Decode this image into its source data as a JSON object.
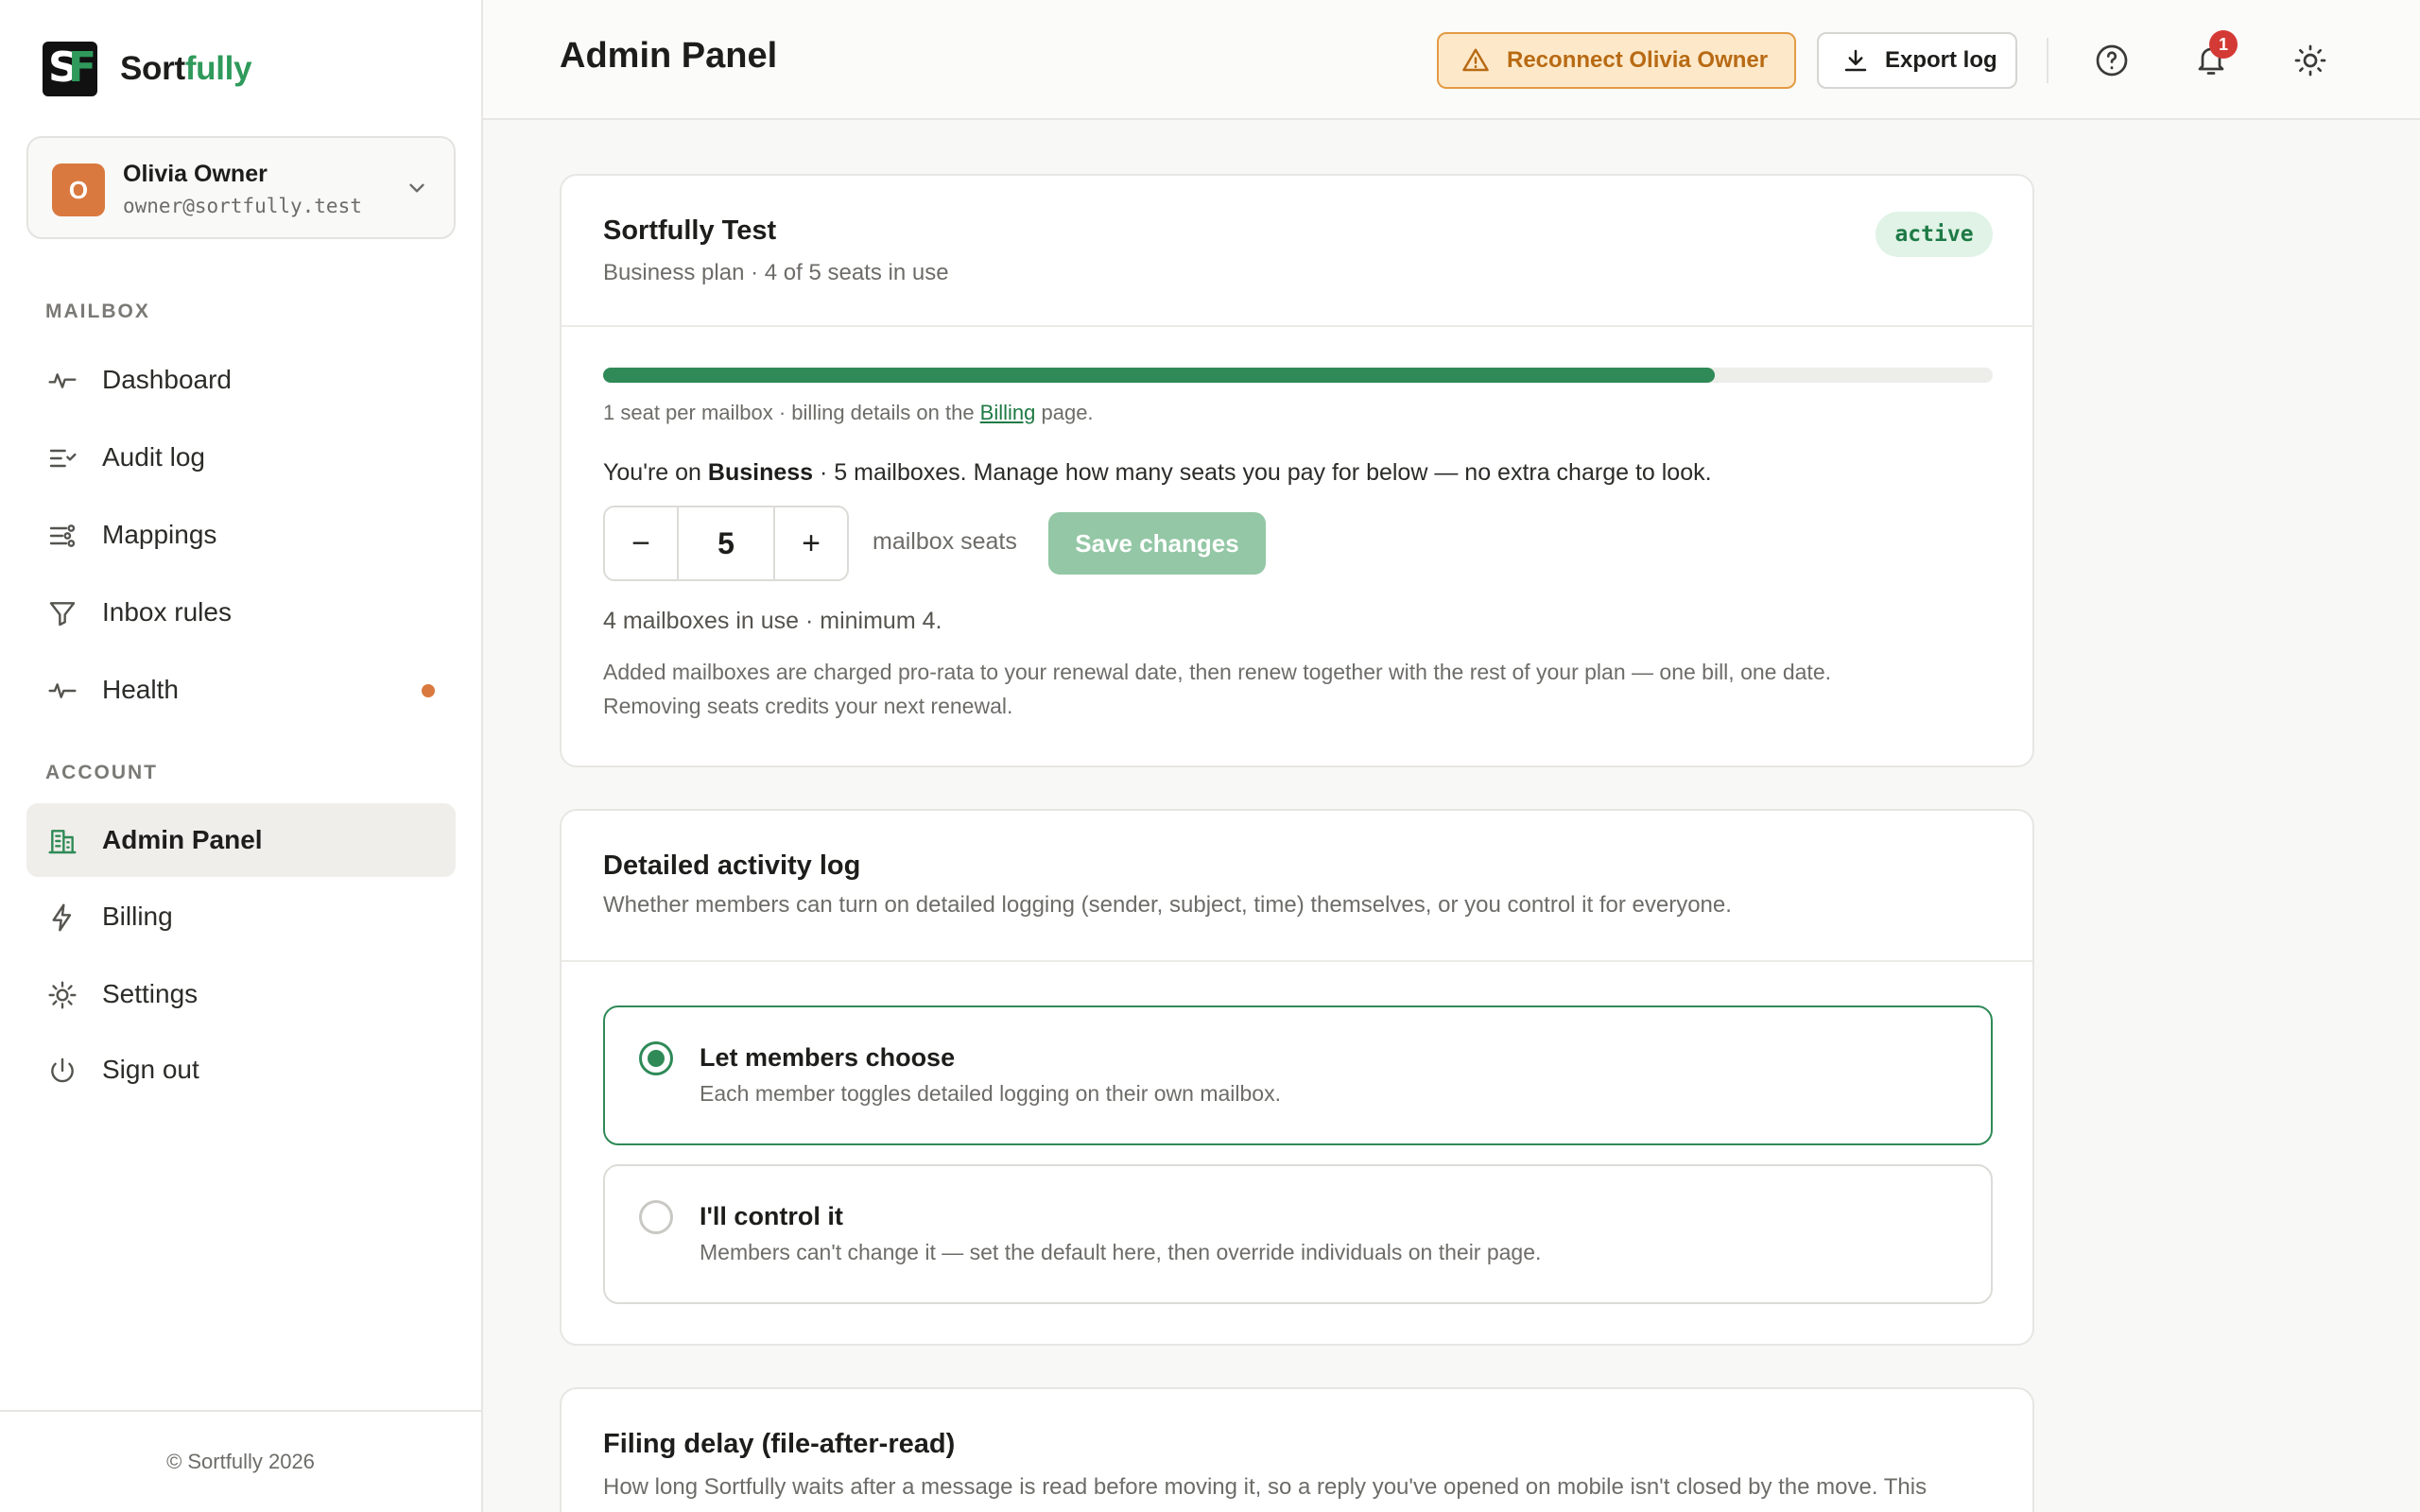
{
  "brand": {
    "name_a": "Sort",
    "name_b": "fully",
    "logo_s": "S",
    "logo_f": "F"
  },
  "user": {
    "initial": "O",
    "name": "Olivia Owner",
    "email": "owner@sortfully.test"
  },
  "sidebar": {
    "mailbox_label": "MAILBOX",
    "account_label": "ACCOUNT",
    "mailbox_items": [
      {
        "label": "Dashboard",
        "icon": "activity-icon"
      },
      {
        "label": "Audit log",
        "icon": "list-check-icon"
      },
      {
        "label": "Mappings",
        "icon": "sliders-icon"
      },
      {
        "label": "Inbox rules",
        "icon": "filter-icon"
      },
      {
        "label": "Health",
        "icon": "pulse-icon"
      }
    ],
    "account_items": [
      {
        "label": "Admin Panel",
        "icon": "building-icon"
      },
      {
        "label": "Billing",
        "icon": "bolt-icon"
      },
      {
        "label": "Settings",
        "icon": "gear-icon"
      },
      {
        "label": "Sign out",
        "icon": "power-icon"
      }
    ],
    "footer": "© Sortfully 2026"
  },
  "header": {
    "title": "Admin Panel",
    "reconnect_label": "Reconnect Olivia Owner",
    "export_label": "Export log",
    "notification_count": "1"
  },
  "plan_card": {
    "title": "Sortfully Test",
    "subtitle": "Business plan · 4 of 5 seats in use",
    "status": "active",
    "seats_used_fraction": 0.8,
    "note_prefix": "1 seat per mailbox · billing details on the ",
    "note_link": "Billing",
    "note_suffix": " page.",
    "line_prefix": "You're on ",
    "line_plan": "Business",
    "line_suffix": " · 5 mailboxes. Manage how many seats you pay for below — no extra charge to look.",
    "stepper_minus": "−",
    "stepper_value": "5",
    "stepper_plus": "+",
    "seat_label": "mailbox seats",
    "save_label": "Save changes",
    "usage_note": "4 mailboxes in use · minimum 4.",
    "prorata_1": "Added mailboxes are charged pro-rata to your renewal date, then renew together with the rest of your plan — one bill, one date.",
    "prorata_2": "Removing seats credits your next renewal."
  },
  "activity_card": {
    "title": "Detailed activity log",
    "subtitle": "Whether members can turn on detailed logging (sender, subject, time) themselves, or you control it for everyone.",
    "options": [
      {
        "title": "Let members choose",
        "desc": "Each member toggles detailed logging on their own mailbox.",
        "selected": true
      },
      {
        "title": "I'll control it",
        "desc": "Members can't change it — set the default here, then override individuals on their page.",
        "selected": false
      }
    ]
  },
  "filing_card": {
    "title": "Filing delay (file-after-read)",
    "subtitle": "How long Sortfully waits after a message is read before moving it, so a reply you've opened on mobile isn't closed by the move. This"
  },
  "colors": {
    "accent": "#2f8a57",
    "warning": "#e49b45",
    "avatar": "#d9793f",
    "badge": "#d43a35"
  }
}
